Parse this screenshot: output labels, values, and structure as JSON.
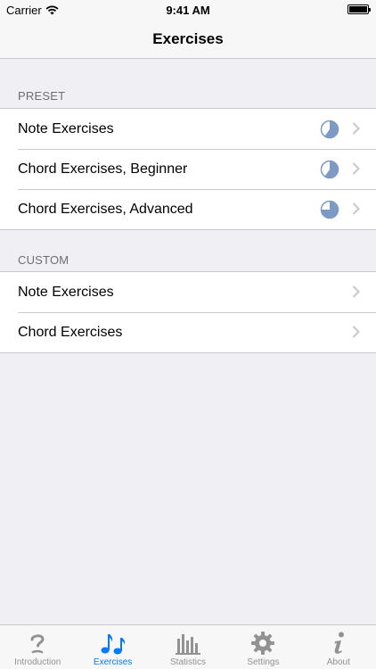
{
  "status_bar": {
    "carrier": "Carrier",
    "time": "9:41 AM"
  },
  "nav": {
    "title": "Exercises"
  },
  "sections": [
    {
      "header": "PRESET",
      "rows": [
        {
          "label": "Note Exercises",
          "progress_icon": "progress-pie-icon",
          "progress": 0.6
        },
        {
          "label": "Chord Exercises, Beginner",
          "progress_icon": "progress-pie-icon",
          "progress": 0.6
        },
        {
          "label": "Chord Exercises, Advanced",
          "progress_icon": "progress-pie-icon",
          "progress": 0.75
        }
      ]
    },
    {
      "header": "CUSTOM",
      "rows": [
        {
          "label": "Note Exercises"
        },
        {
          "label": "Chord Exercises"
        }
      ]
    }
  ],
  "tabs": [
    {
      "label": "Introduction",
      "icon": "question-icon",
      "active": false
    },
    {
      "label": "Exercises",
      "icon": "music-notes-icon",
      "active": true
    },
    {
      "label": "Statistics",
      "icon": "bar-chart-icon",
      "active": false
    },
    {
      "label": "Settings",
      "icon": "gear-icon",
      "active": false
    },
    {
      "label": "About",
      "icon": "info-icon",
      "active": false
    }
  ],
  "colors": {
    "accent": "#007aff",
    "progress": "#7d9ac4",
    "inactive_tab": "#929292",
    "background": "#efeff4"
  }
}
